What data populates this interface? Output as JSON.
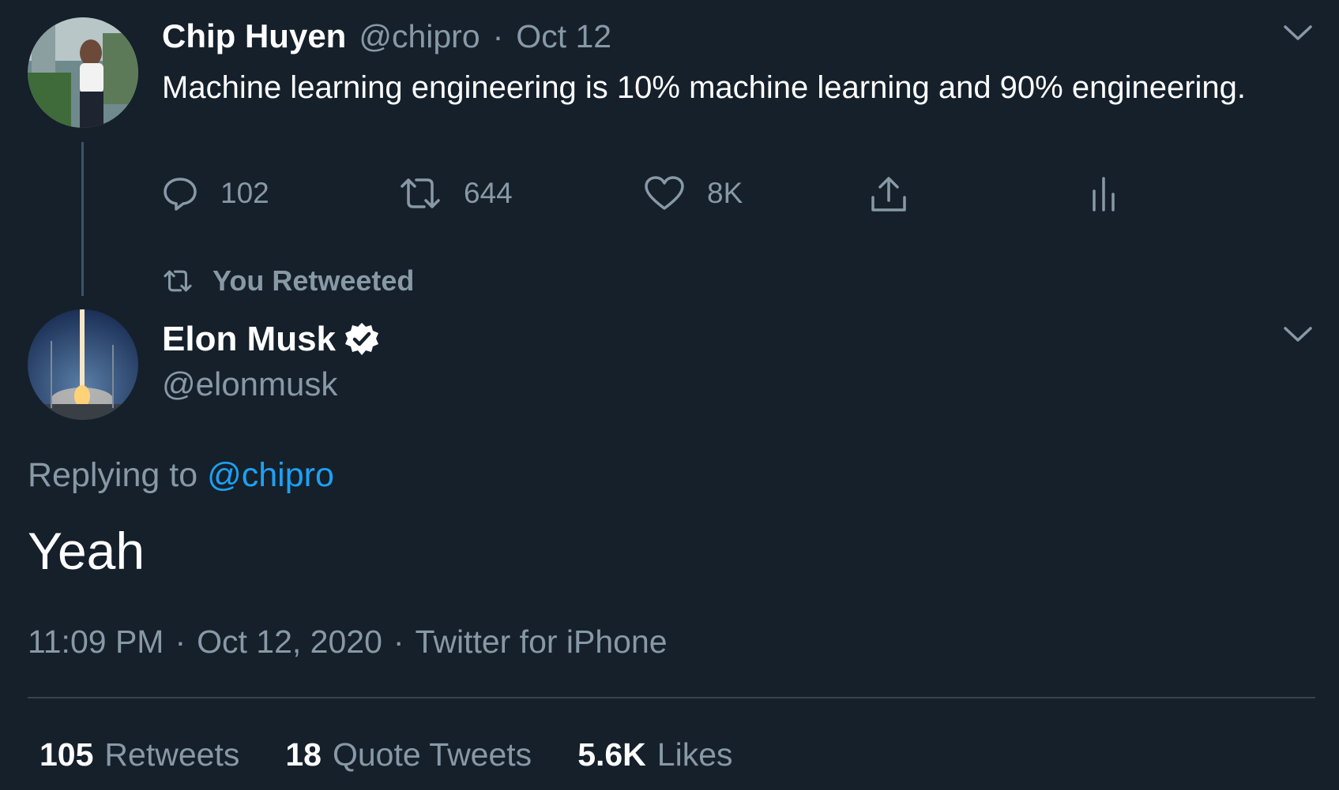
{
  "tweet1": {
    "display_name": "Chip Huyen",
    "handle": "@chipro",
    "separator": "·",
    "date": "Oct 12",
    "text": "Machine learning engineering is 10% machine learning and 90% engineering.",
    "actions": {
      "reply_count": "102",
      "retweet_count": "644",
      "like_count": "8K"
    }
  },
  "retweet_notice": {
    "label": "You Retweeted"
  },
  "tweet2": {
    "display_name": "Elon Musk",
    "handle": "@elonmusk",
    "replying_prefix": "Replying to",
    "replying_to": "@chipro",
    "text": "Yeah",
    "time": "11:09 PM",
    "date": "Oct 12, 2020",
    "source": "Twitter for iPhone",
    "meta_separator": "·",
    "stats": {
      "retweets_count": "105",
      "retweets_label": "Retweets",
      "quotes_count": "18",
      "quotes_label": "Quote Tweets",
      "likes_count": "5.6K",
      "likes_label": "Likes"
    }
  },
  "icons": [
    "reply-icon",
    "retweet-icon",
    "like-icon",
    "share-icon",
    "analytics-icon",
    "chevron-down-icon",
    "verified-badge-icon"
  ],
  "colors": {
    "background": "#15202b",
    "muted": "#8899a6",
    "link": "#1da1f2",
    "divider": "#38444d"
  }
}
